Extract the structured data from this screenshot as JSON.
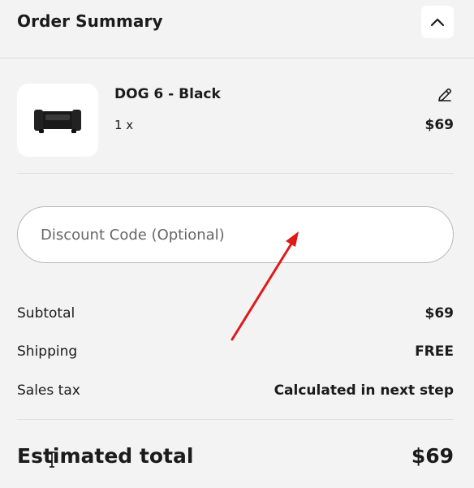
{
  "header": {
    "title": "Order Summary",
    "toggle_icon": "chevron-up-icon"
  },
  "product": {
    "name": "DOG 6 - Black",
    "quantity": "1 x",
    "price": "$69",
    "edit_icon": "pencil-icon",
    "image_icon": "black-dog-device-image"
  },
  "discount": {
    "placeholder": "Discount Code (Optional)",
    "value": ""
  },
  "summary": {
    "rows": [
      {
        "label": "Subtotal",
        "value": "$69"
      },
      {
        "label": "Shipping",
        "value": "FREE"
      },
      {
        "label": "Sales tax",
        "value": "Calculated in next step"
      }
    ]
  },
  "total": {
    "label": "Estimated total",
    "value": "$69"
  },
  "annotation": {
    "arrow_color": "#e01919"
  },
  "colors": {
    "background": "#f3f3f3",
    "text": "#1b1b1b",
    "card": "#ffffff",
    "divider": "#dedede"
  }
}
